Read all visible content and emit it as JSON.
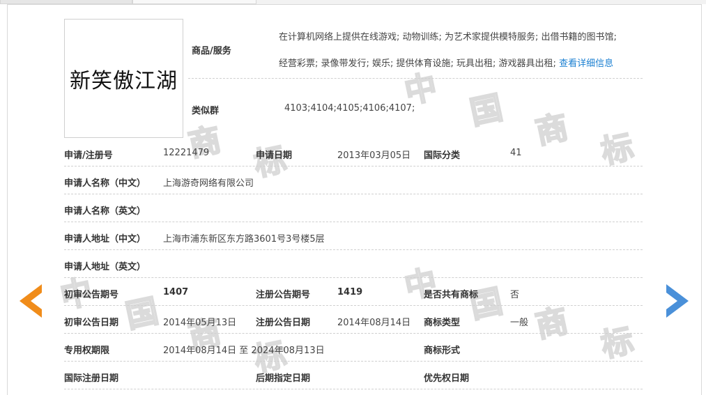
{
  "watermark": {
    "chars": [
      "中",
      "国",
      "商",
      "标"
    ],
    "text": "中国商标"
  },
  "trademark": {
    "logo_text": "新笑傲江湖",
    "goods_label": "商品/服务",
    "goods_line1": "在计算机网络上提供在线游戏; 动物训练; 为艺术家提供模特服务; 出借书籍的图书馆;",
    "goods_line2": "经营彩票; 录像带发行; 娱乐; 提供体育设施; 玩具出租; 游戏器具出租;",
    "detail_link": "查看详细信息",
    "similar_label": "类似群",
    "similar_value": "4103;4104;4105;4106;4107;"
  },
  "rows": {
    "reg_no_label": "申请/注册号",
    "reg_no": "12221479",
    "apply_date_label": "申请日期",
    "apply_date": "2013年03月05日",
    "intl_class_label": "国际分类",
    "intl_class": "41",
    "applicant_cn_label": "申请人名称（中文）",
    "applicant_cn": "上海游奇网络有限公司",
    "applicant_en_label": "申请人名称（英文）",
    "address_cn_label": "申请人地址（中文）",
    "address_cn": "上海市浦东新区东方路3601号3号楼5层",
    "address_en_label": "申请人地址（英文）",
    "prelim_no_label": "初审公告期号",
    "prelim_no": "1407",
    "reg_pub_no_label": "注册公告期号",
    "reg_pub_no": "1419",
    "shared_label": "是否共有商标",
    "shared": "否",
    "prelim_date_label": "初审公告日期",
    "prelim_date": "2014年05月13日",
    "reg_pub_date_label": "注册公告日期",
    "reg_pub_date": "2014年08月14日",
    "tm_type_label": "商标类型",
    "tm_type": "一般",
    "exclusive_label": "专用权期限",
    "exclusive": "2014年08月14日 至 2024年08月13日",
    "tm_form_label": "商标形式",
    "intl_reg_date_label": "国际注册日期",
    "later_date_label": "后期指定日期",
    "priority_date_label": "优先权日期"
  },
  "colors": {
    "prev_arrow": "#f08c1a",
    "next_arrow": "#4a90d9",
    "link": "#1a7fd1"
  },
  "icons": {
    "prev": "chevron-left-icon",
    "next": "chevron-right-icon"
  }
}
